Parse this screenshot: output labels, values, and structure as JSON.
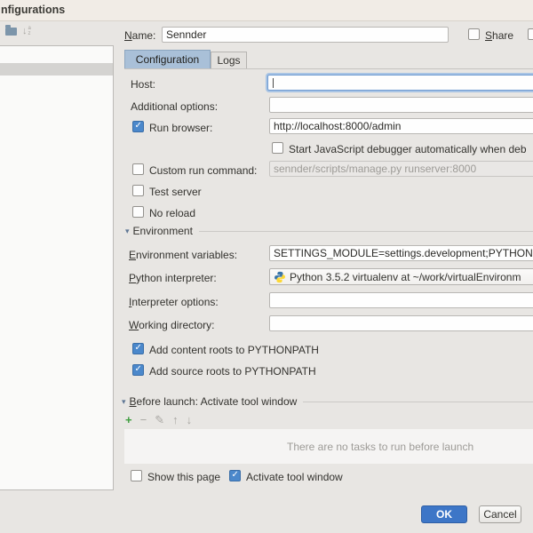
{
  "colors": {
    "accent_blue": "#3d76c7",
    "tab_selected_blue": "#a9c0d8",
    "checkbox_checked_blue": "#4b88cb",
    "add_icon_green": "#3f9e3f",
    "focus_ring_blue": "#a8c4e4"
  },
  "window": {
    "title": "nfigurations"
  },
  "header": {
    "name_label": "Name:",
    "name_value": "Sennder",
    "share_label": "Share"
  },
  "tabs": {
    "configuration": "Configuration",
    "logs": "Logs"
  },
  "form": {
    "host_label": "Host:",
    "host_value": "",
    "additional_options_label": "Additional options:",
    "additional_options_value": "",
    "run_browser_label": "Run browser:",
    "run_browser_checked": true,
    "run_browser_url": "http://localhost:8000/admin",
    "start_js_label": "Start JavaScript debugger automatically when deb",
    "start_js_checked": false,
    "custom_run_label": "Custom run command:",
    "custom_run_checked": false,
    "custom_run_value": "sennder/scripts/manage.py runserver:8000",
    "test_server_label": "Test server",
    "test_server_checked": false,
    "no_reload_label": "No reload",
    "no_reload_checked": false,
    "environment_section_label": "Environment",
    "env_vars_label": "Environment variables:",
    "env_vars_value": "SETTINGS_MODULE=settings.development;PYTHONU",
    "python_interpreter_label": "Python interpreter:",
    "python_interpreter_value": "Python 3.5.2 virtualenv at ~/work/virtualEnvironm",
    "interpreter_options_label": "Interpreter options:",
    "interpreter_options_value": "",
    "working_directory_label": "Working directory:",
    "working_directory_value": "",
    "add_content_roots_label": "Add content roots to PYTHONPATH",
    "add_content_roots_checked": true,
    "add_source_roots_label": "Add source roots to PYTHONPATH",
    "add_source_roots_checked": true
  },
  "before_launch": {
    "section_label": "Before launch: Activate tool window",
    "empty_message": "There are no tasks to run before launch",
    "icons": {
      "add": "+",
      "remove": "−",
      "edit": "✎",
      "move_up": "↑",
      "move_down": "↓"
    }
  },
  "footer": {
    "show_this_page_label": "Show this page",
    "show_this_page_checked": false,
    "activate_tool_window_label": "Activate tool window",
    "activate_tool_window_checked": true,
    "ok_label": "OK",
    "cancel_label": "Cancel"
  },
  "icons": {
    "collapse_triangle": "▾",
    "sort_arrow": "↓",
    "sort_letter_a": "a",
    "sort_letter_z": "z"
  }
}
